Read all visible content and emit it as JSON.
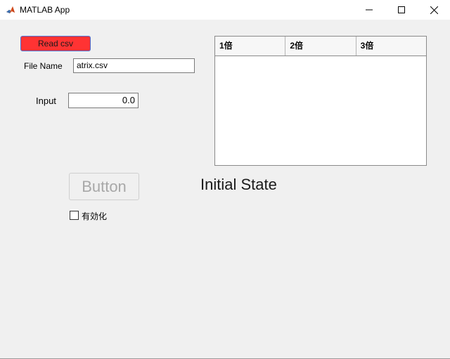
{
  "window": {
    "title": "MATLAB App"
  },
  "controls": {
    "read_button_label": "Read csv",
    "read_button_color": "#ff3333",
    "file_name_label": "File Name",
    "file_name_value": "atrix.csv",
    "input_label": "Input",
    "input_value": "0.0",
    "button_label": "Button",
    "checkbox_label": "有効化",
    "checkbox_checked": false,
    "state_label": "Initial State"
  },
  "table": {
    "columns": [
      "1倍",
      "2倍",
      "3倍"
    ],
    "rows": []
  },
  "icons": {
    "app": "matlab-logo-icon",
    "minimize": "minimize-icon",
    "maximize": "maximize-icon",
    "close": "close-icon"
  }
}
